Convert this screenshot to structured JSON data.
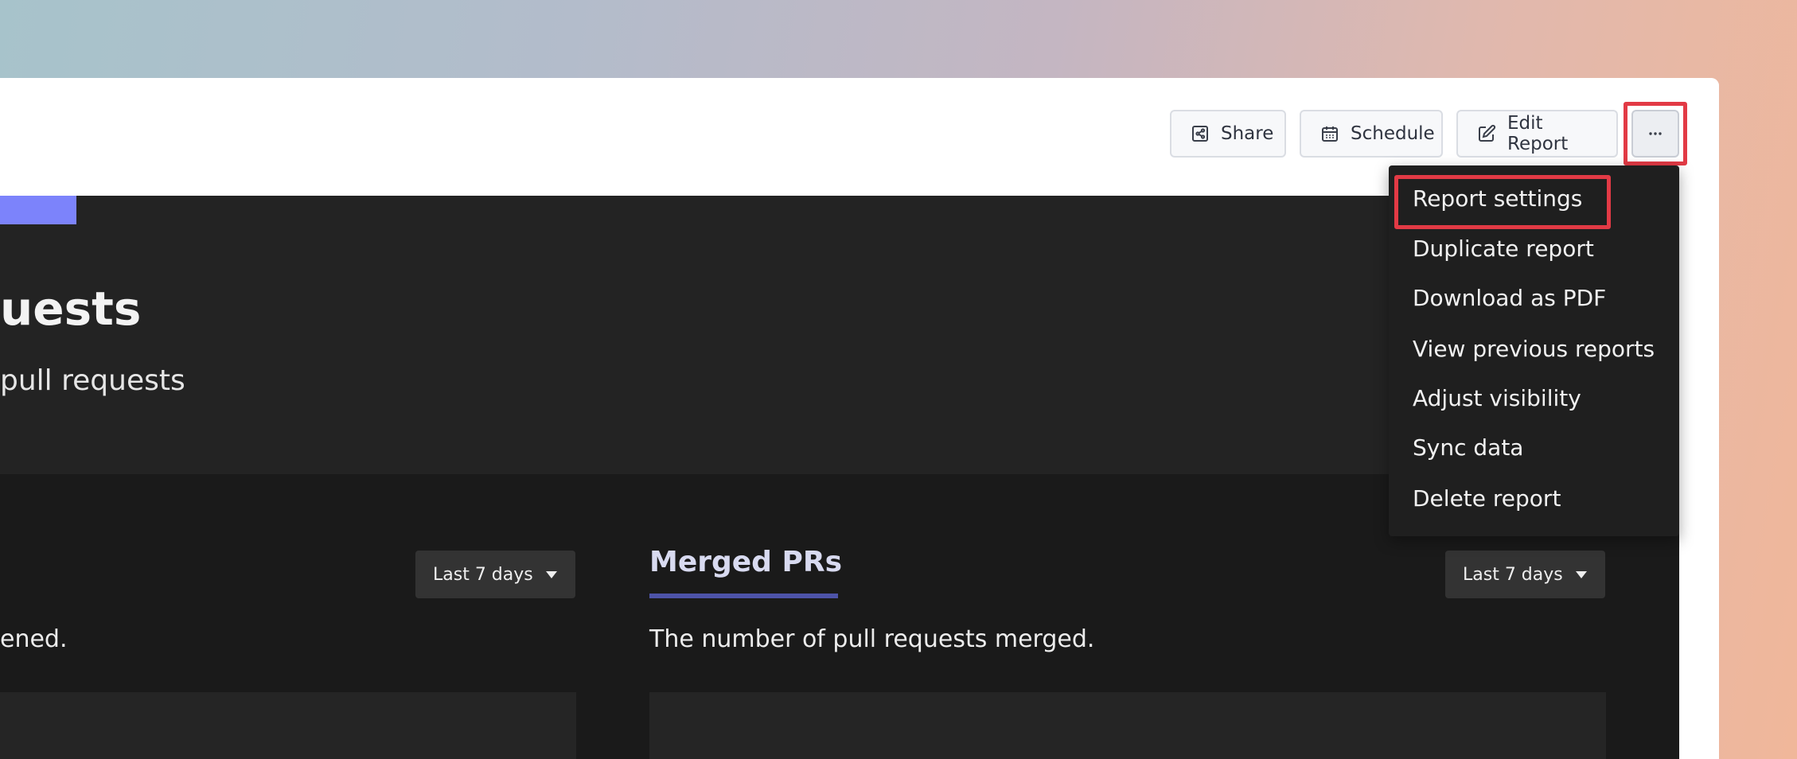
{
  "toolbar": {
    "share_label": "Share",
    "schedule_label": "Schedule",
    "edit_report_label": "Edit Report",
    "more_icon": "ellipsis-icon"
  },
  "hero": {
    "title": "uests",
    "subtitle": "pull requests"
  },
  "cards": {
    "left": {
      "range_label": "Last 7 days",
      "description": "ened."
    },
    "right": {
      "title": "Merged PRs",
      "range_label": "Last 7 days",
      "description": "The number of pull requests merged."
    }
  },
  "menu": {
    "items": [
      {
        "label": "Report settings"
      },
      {
        "label": "Duplicate report"
      },
      {
        "label": "Download as PDF"
      },
      {
        "label": "View previous reports"
      },
      {
        "label": "Adjust visibility"
      },
      {
        "label": "Sync data"
      },
      {
        "label": "Delete report"
      }
    ]
  },
  "colors": {
    "accent": "#7c83fb",
    "highlight": "#e23a45",
    "underline": "#4d53a8"
  }
}
